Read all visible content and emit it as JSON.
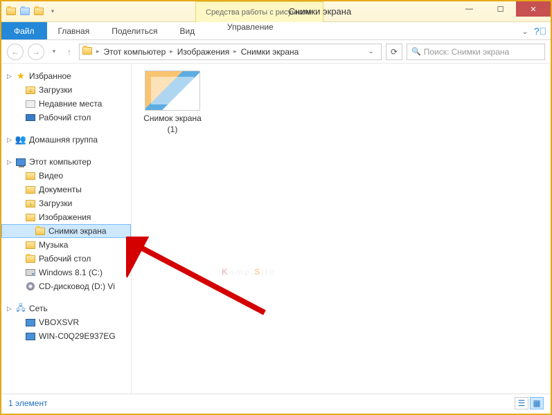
{
  "titlebar": {
    "context_tab": "Средства работы с рисунками",
    "title": "Снимки экрана"
  },
  "ribbon": {
    "file": "Файл",
    "tabs": [
      "Главная",
      "Поделиться",
      "Вид"
    ],
    "context_tab": "Управление"
  },
  "breadcrumb": {
    "items": [
      "Этот компьютер",
      "Изображения",
      "Снимки экрана"
    ]
  },
  "search": {
    "placeholder": "Поиск: Снимки экрана"
  },
  "sidebar": {
    "favorites": {
      "label": "Избранное",
      "items": [
        "Загрузки",
        "Недавние места",
        "Рабочий стол"
      ]
    },
    "homegroup": {
      "label": "Домашняя группа"
    },
    "computer": {
      "label": "Этот компьютер",
      "items": [
        "Видео",
        "Документы",
        "Загрузки",
        "Изображения"
      ],
      "selected": "Снимки экрана",
      "items2": [
        "Музыка",
        "Рабочий стол",
        "Windows 8.1 (C:)",
        "CD-дисковод (D:) Vi"
      ]
    },
    "network": {
      "label": "Сеть",
      "items": [
        "VBOXSVR",
        "WIN-C0Q29E937EG"
      ]
    }
  },
  "content": {
    "file_name": "Снимок экрана (1)"
  },
  "statusbar": {
    "count": "1 элемент"
  },
  "watermark": {
    "p1": "K",
    "p2": "omp",
    "p3": ".",
    "p4": "S",
    "p5": "ite"
  }
}
